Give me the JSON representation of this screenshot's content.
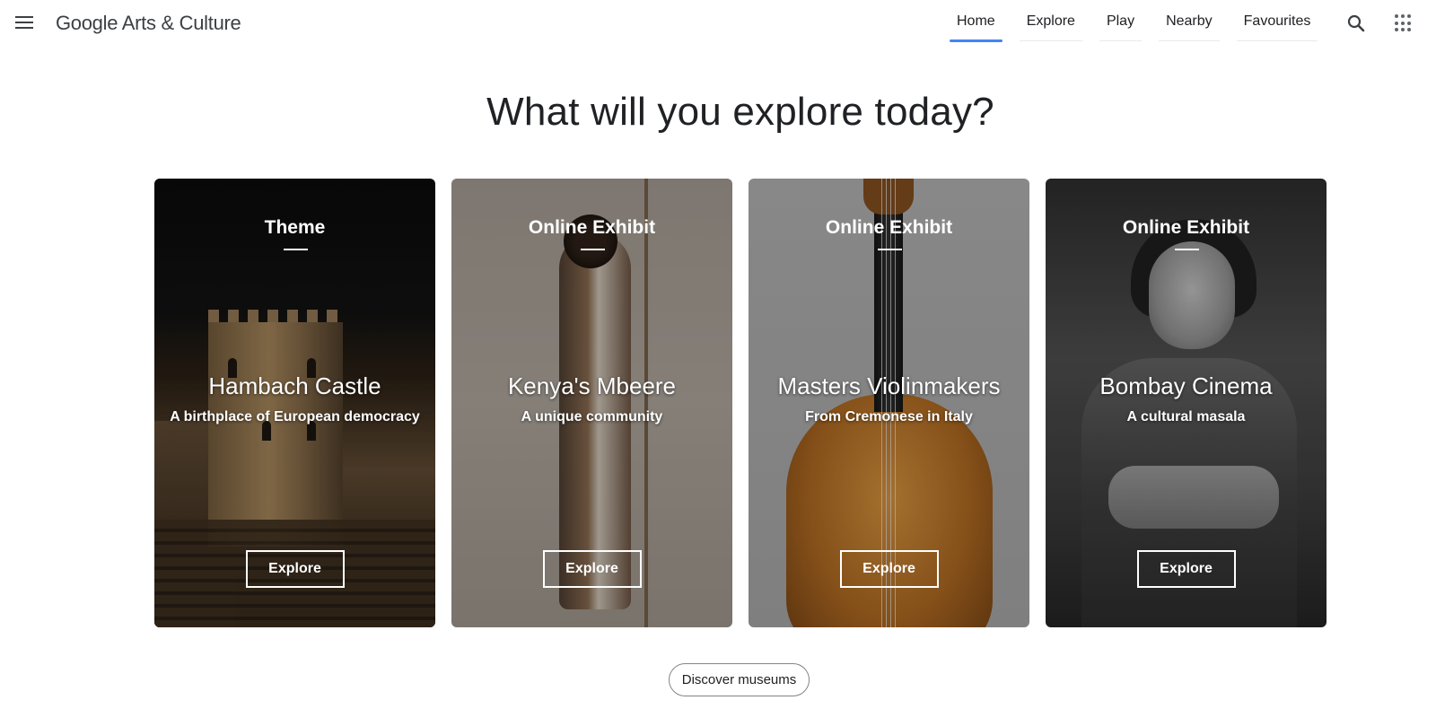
{
  "header": {
    "logo": "Google Arts & Culture",
    "nav": [
      {
        "label": "Home",
        "active": true
      },
      {
        "label": "Explore",
        "active": false
      },
      {
        "label": "Play",
        "active": false
      },
      {
        "label": "Nearby",
        "active": false
      },
      {
        "label": "Favourites",
        "active": false
      }
    ],
    "icons": {
      "menu": "menu-icon",
      "search": "search-icon",
      "apps": "apps-grid-icon"
    }
  },
  "hero": {
    "title": "What will you explore today?"
  },
  "cards": [
    {
      "kind": "Theme",
      "title": "Hambach Castle",
      "subtitle": "A birthplace of European democracy",
      "button": "Explore"
    },
    {
      "kind": "Online Exhibit",
      "title": "Kenya's Mbeere",
      "subtitle": "A unique community",
      "button": "Explore"
    },
    {
      "kind": "Online Exhibit",
      "title": "Masters Violinmakers",
      "subtitle": "From Cremonese in Italy",
      "button": "Explore"
    },
    {
      "kind": "Online Exhibit",
      "title": "Bombay Cinema",
      "subtitle": "A cultural masala",
      "button": "Explore"
    }
  ],
  "footer": {
    "discover_button": "Discover museums"
  },
  "colors": {
    "accent": "#4285f4",
    "text": "#202124"
  }
}
